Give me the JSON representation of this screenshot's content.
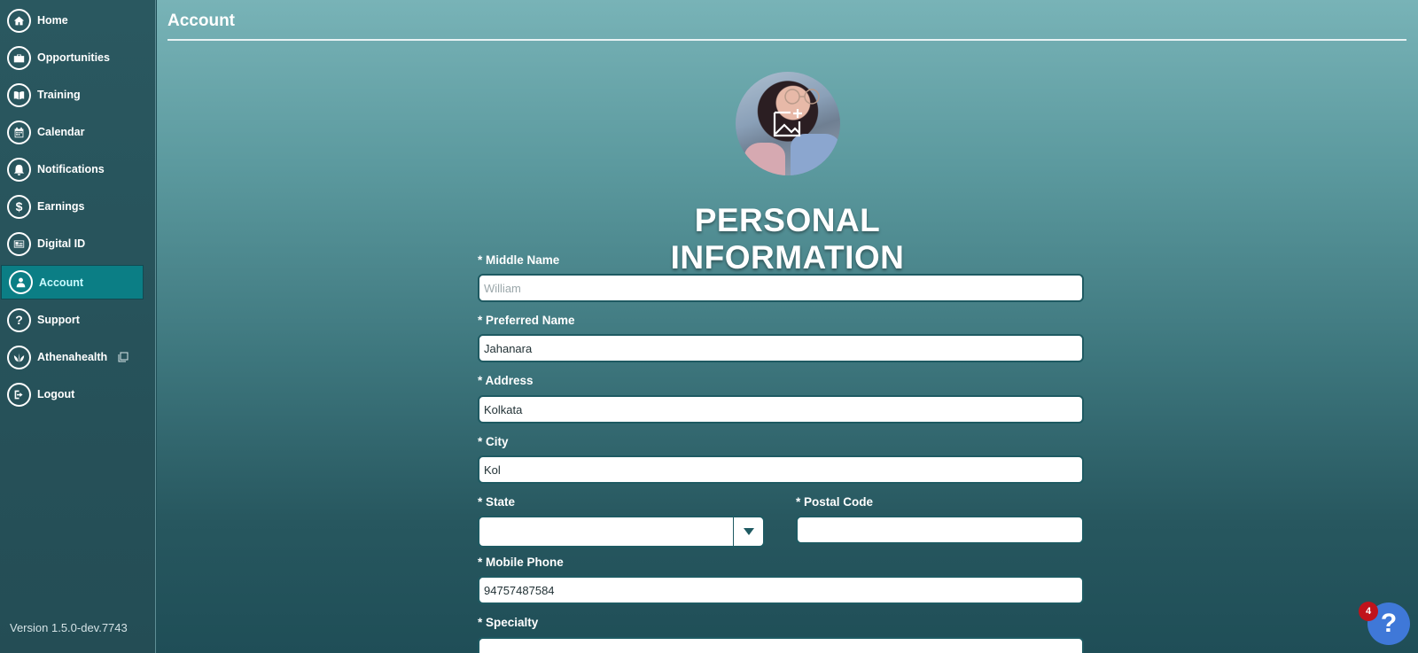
{
  "sidebar": {
    "items": [
      {
        "label": "Home",
        "icon": "home-icon"
      },
      {
        "label": "Opportunities",
        "icon": "briefcase-icon"
      },
      {
        "label": "Training",
        "icon": "book-icon"
      },
      {
        "label": "Calendar",
        "icon": "calendar-icon"
      },
      {
        "label": "Notifications",
        "icon": "bell-icon"
      },
      {
        "label": "Earnings",
        "icon": "dollar-icon"
      },
      {
        "label": "Digital ID",
        "icon": "id-card-icon"
      },
      {
        "label": "Account",
        "icon": "user-icon",
        "active": true
      },
      {
        "label": "Support",
        "icon": "question-icon"
      },
      {
        "label": "Athenahealth",
        "icon": "leaf-icon",
        "external": true
      },
      {
        "label": "Logout",
        "icon": "logout-icon"
      }
    ],
    "version": "Version 1.5.0-dev.7743"
  },
  "header": {
    "title": "Account"
  },
  "form": {
    "title": "PERSONAL INFORMATION",
    "middle_name": {
      "label": "* Middle Name",
      "value": "",
      "placeholder": "William"
    },
    "preferred_name": {
      "label": "* Preferred Name",
      "value": "Jahanara"
    },
    "address": {
      "label": "* Address",
      "value": "Kolkata"
    },
    "city": {
      "label": "* City",
      "value": "Kol"
    },
    "state": {
      "label": "* State",
      "value": ""
    },
    "postal_code": {
      "label": "* Postal Code",
      "value": ""
    },
    "mobile_phone": {
      "label": "* Mobile Phone",
      "value": "94757487584"
    },
    "specialty": {
      "label": "* Specialty"
    }
  },
  "help": {
    "label": "?",
    "badge": "4"
  },
  "colors": {
    "accent": "#0b7e85",
    "help": "#3f78d8",
    "badge": "#c0131b"
  }
}
